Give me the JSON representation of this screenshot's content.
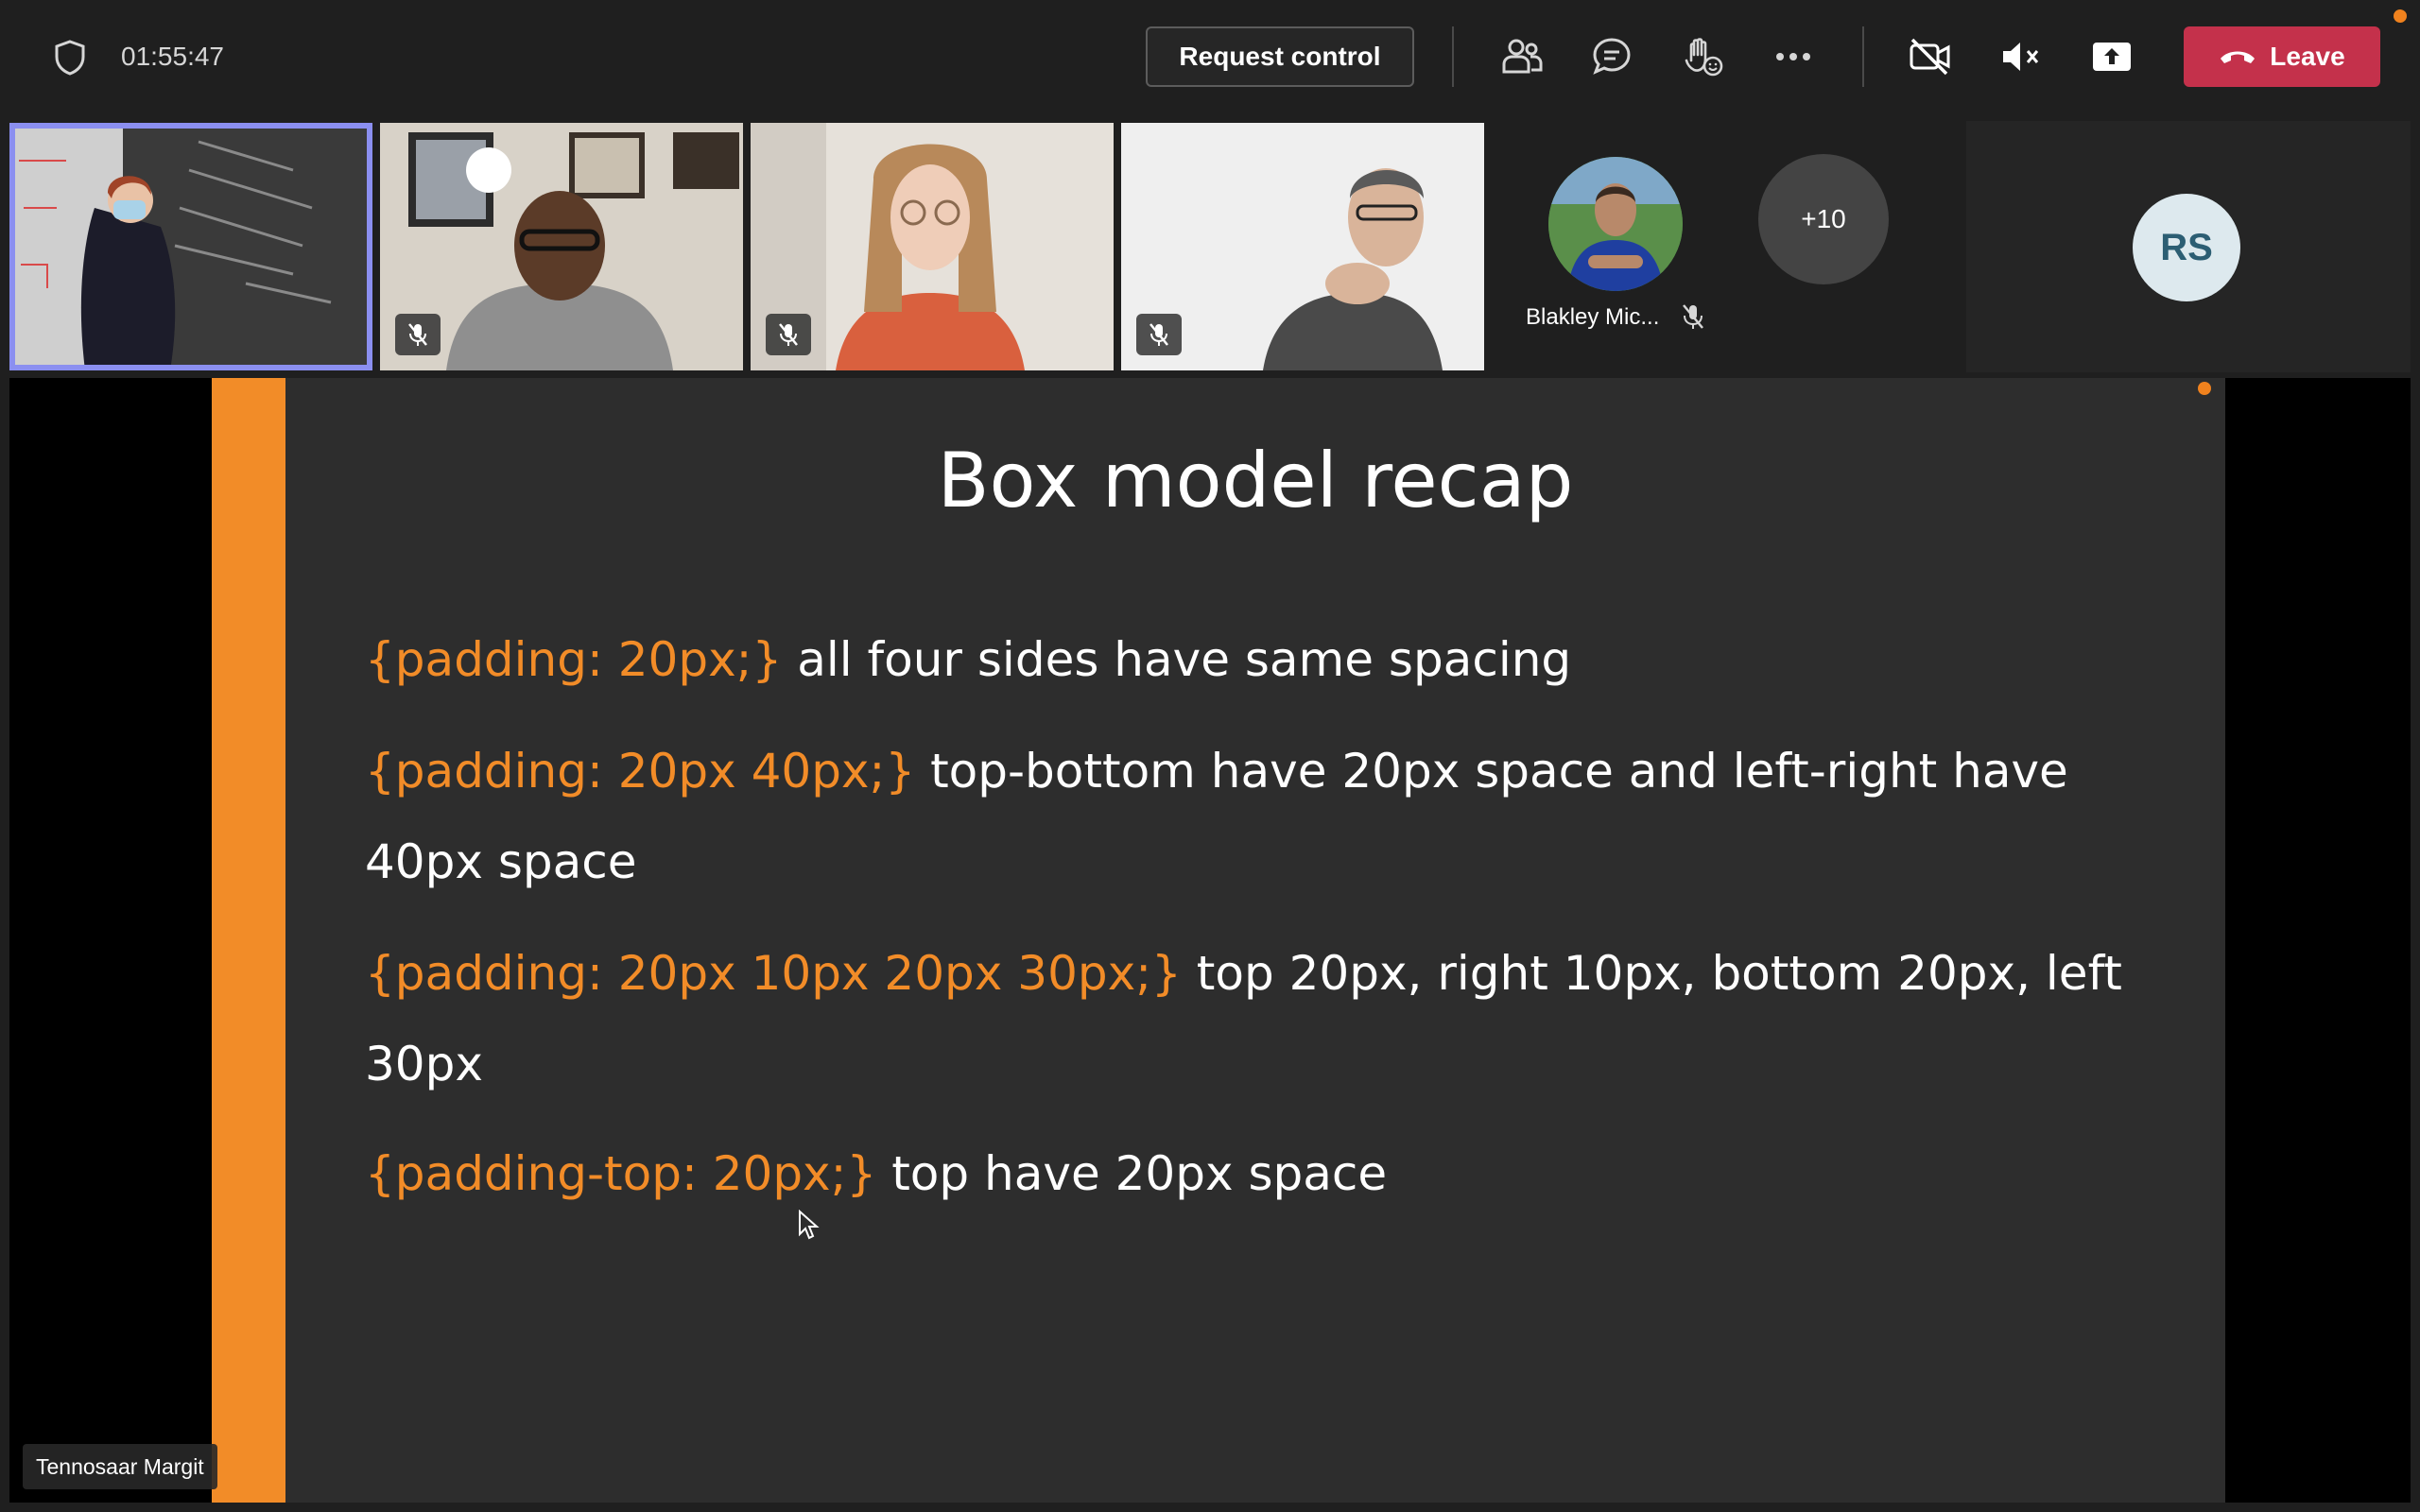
{
  "toolbar": {
    "timer": "01:55:47",
    "request_control_label": "Request control",
    "leave_label": "Leave",
    "colors": {
      "leave": "#c4314b",
      "accent": "#8b8ff0",
      "notification": "#f0821e"
    },
    "icons": [
      "shield-icon",
      "people-icon",
      "chat-icon",
      "raise-hand-icon",
      "more-icon",
      "camera-off-icon",
      "mic-off-icon",
      "share-screen-icon",
      "phone-hangup-icon"
    ]
  },
  "participants": {
    "named_tile": {
      "name": "Blakley Mic...",
      "muted": true
    },
    "overflow_label": "+10",
    "initials_avatar": "RS",
    "video_tiles": [
      {
        "muted": false,
        "selected": true
      },
      {
        "muted": true,
        "selected": false
      },
      {
        "muted": true,
        "selected": false
      },
      {
        "muted": true,
        "selected": false
      }
    ]
  },
  "stage": {
    "presenter_name": "Tennosaar Margit",
    "slide": {
      "title": "Box model recap",
      "accent_color": "#f28c28",
      "lines": [
        {
          "code": "{padding: 20px;}",
          "text": " all four sides have same spacing"
        },
        {
          "code": "{padding: 20px 40px;}",
          "text": " top-bottom have 20px space and left-right have 40px space"
        },
        {
          "code": "{padding: 20px 10px 20px 30px;}",
          "text": " top 20px, right 10px, bottom 20px, left 30px"
        },
        {
          "code": "{padding-top: 20px;}",
          "text": " top have 20px space"
        }
      ]
    }
  }
}
